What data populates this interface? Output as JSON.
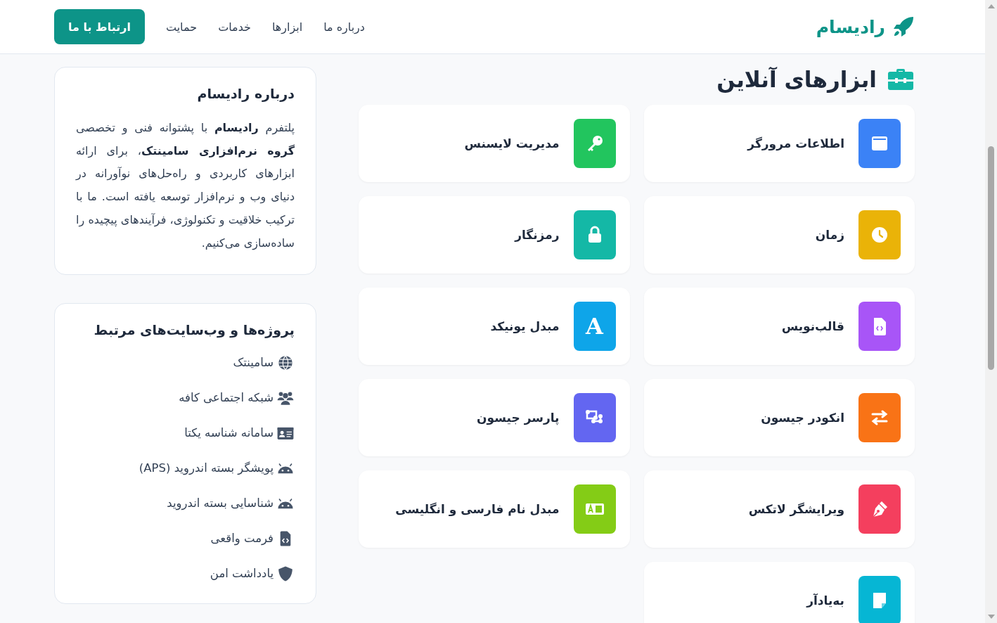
{
  "header": {
    "brand": "رادیسام",
    "nav": [
      {
        "label": "درباره ما"
      },
      {
        "label": "ابزارها"
      },
      {
        "label": "خدمات"
      },
      {
        "label": "حمایت"
      }
    ],
    "cta": "ارتباط با ما"
  },
  "tools": {
    "title": "ابزارهای آنلاین",
    "items": [
      {
        "name": "اطلاعات مرورگر",
        "kind": "browser",
        "color": "#3b82f6"
      },
      {
        "name": "مدیریت لایسنس",
        "kind": "key",
        "color": "#22c55e"
      },
      {
        "name": "زمان",
        "kind": "clock",
        "color": "#eab308"
      },
      {
        "name": "رمزنگار",
        "kind": "lock",
        "color": "#14b8a6"
      },
      {
        "name": "قالب‌نویس",
        "kind": "filecode",
        "color": "#a855f7"
      },
      {
        "name": "مبدل یونیکد",
        "kind": "letter",
        "glyph": "A",
        "color": "#0ea5e9"
      },
      {
        "name": "انکودر جیسون",
        "kind": "arrows",
        "color": "#f97316"
      },
      {
        "name": "پارسر جیسون",
        "kind": "nodes",
        "color": "#6366f1"
      },
      {
        "name": "ویرایشگر لاتکس",
        "kind": "pen",
        "color": "#f43f5e"
      },
      {
        "name": "مبدل نام فارسی و انگلیسی",
        "kind": "translate",
        "color": "#84cc16"
      },
      {
        "name": "به‌یادآر",
        "kind": "note",
        "color": "#06b6d4"
      }
    ]
  },
  "about": {
    "title": "درباره رادیسام",
    "text": "پلتفرم **رادیسام** با پشتوانه فنی و تخصصی **گروه نرم‌افزاری سامینتک**، برای ارائه ابزارهای کاربردی و راه‌حل‌های نوآورانه در دنیای وب و نرم‌افزار توسعه یافته است. ما با ترکیب خلاقیت و تکنولوژی، فرآیندهای پیچیده را ساده‌سازی می‌کنیم."
  },
  "projects": {
    "title": "پروژه‌ها و وب‌سایت‌های مرتبط",
    "items": [
      {
        "label": "سامینتک",
        "kind": "globe"
      },
      {
        "label": "شبکه اجتماعی کافه",
        "kind": "users"
      },
      {
        "label": "سامانه شناسه یکتا",
        "kind": "idcard"
      },
      {
        "label": "پویشگر بسته اندروید (APS)",
        "kind": "android"
      },
      {
        "label": "شناسایی بسته اندروید",
        "kind": "android"
      },
      {
        "label": "فرمت واقعی",
        "kind": "doccode"
      },
      {
        "label": "یادداشت امن",
        "kind": "shield"
      }
    ]
  }
}
